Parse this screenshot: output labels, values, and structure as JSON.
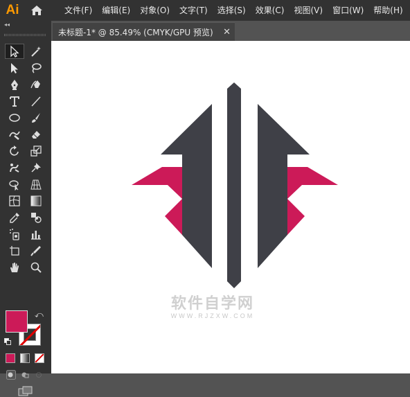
{
  "app": {
    "logo_text": "Ai",
    "accent_color": "#ff9a00"
  },
  "menu": {
    "items": [
      "文件(F)",
      "编辑(E)",
      "对象(O)",
      "文字(T)",
      "选择(S)",
      "效果(C)",
      "视图(V)",
      "窗口(W)",
      "帮助(H)"
    ]
  },
  "panel": {
    "collapse_glyph": "◂◂"
  },
  "document": {
    "tab_title": "未标题-1* @ 85.49% (CMYK/GPU 预览)",
    "close_glyph": "✕"
  },
  "toolbar": {
    "tools": [
      "selection-tool",
      "magic-wand-tool",
      "direct-selection-tool",
      "lasso-tool",
      "pen-tool",
      "curvature-tool",
      "type-tool",
      "line-segment-tool",
      "ellipse-tool",
      "paintbrush-tool",
      "shaper-tool",
      "eraser-tool",
      "rotate-tool",
      "scale-tool",
      "puppet-warp-tool",
      "pin-tool",
      "free-transform-tool",
      "perspective-grid-tool",
      "mesh-tool",
      "gradient-tool",
      "eyedropper-tool",
      "blend-tool",
      "symbol-sprayer-tool",
      "column-graph-tool",
      "artboard-tool",
      "slice-tool",
      "hand-tool",
      "zoom-tool"
    ],
    "fill_color": "#cc1a58",
    "stroke_color": "none"
  },
  "artwork": {
    "dark_color": "#3f4047",
    "accent_color": "#cc1a58"
  },
  "watermark": {
    "main_text": "软件自学网",
    "url_text": "WWW.RJZXW.COM"
  }
}
